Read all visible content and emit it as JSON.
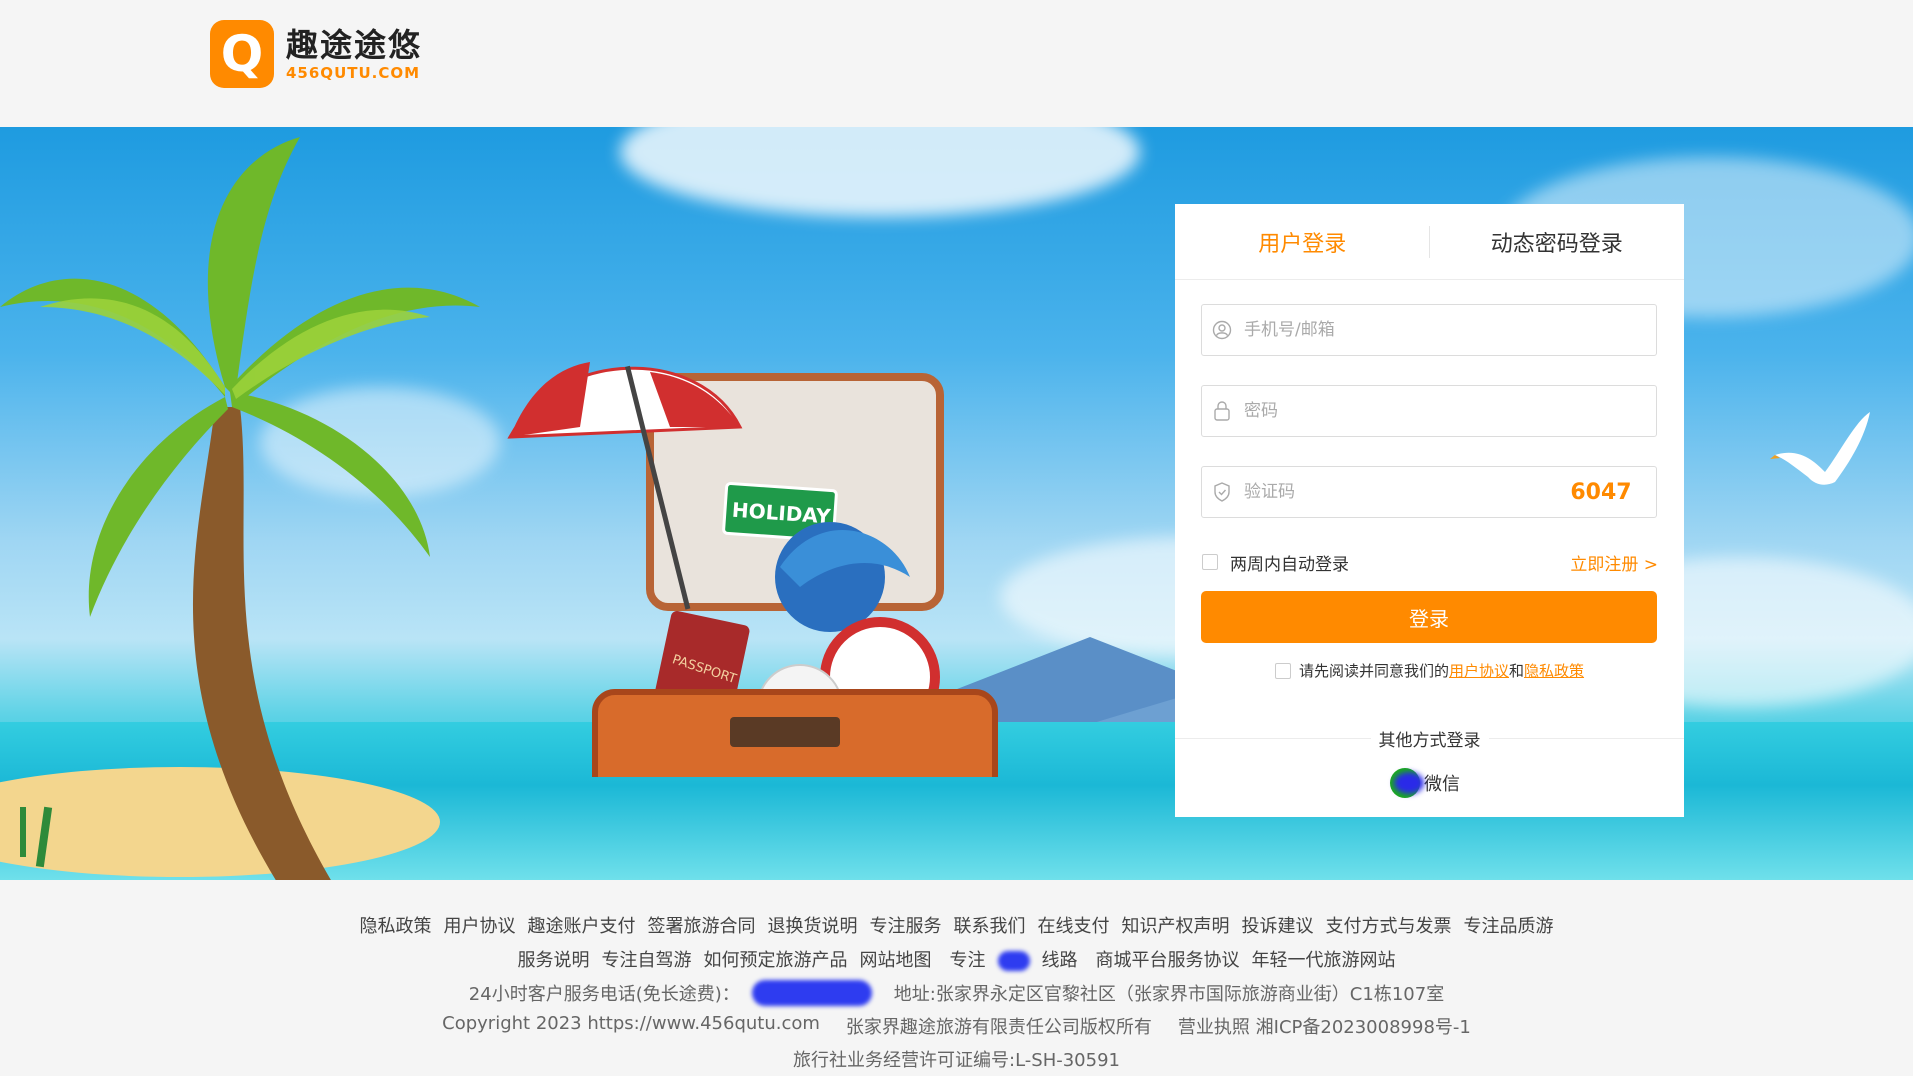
{
  "header": {
    "logo_mark": "Q",
    "logo_cn": "趣途途悠",
    "logo_en": "456QUTU.COM"
  },
  "hero": {
    "sign_text": "HOLIDAY",
    "passport_text": "PASSPORT"
  },
  "login": {
    "tabs": [
      {
        "label": "用户登录",
        "active": true
      },
      {
        "label": "动态密码登录",
        "active": false
      }
    ],
    "phone_placeholder": "手机号/邮箱",
    "password_placeholder": "密码",
    "captcha_placeholder": "验证码",
    "captcha_code": "6047",
    "remember_label": "两周内自动登录",
    "register_link": "立即注册 >",
    "submit_label": "登录",
    "agree_prefix": "请先阅读并同意我们的",
    "agree_user_link": "用户协议",
    "agree_and": "和",
    "agree_privacy_link": "隐私政策",
    "other_title": "其他方式登录",
    "wechat_label": "微信"
  },
  "footer": {
    "links_row1": [
      "隐私政策",
      "用户协议",
      "趣途账户支付",
      "签署旅游合同",
      "退换货说明",
      "专注服务",
      "联系我们",
      "在线支付",
      "知识产权声明",
      "投诉建议",
      "支付方式与发票",
      "专注品质游"
    ],
    "links_row2": [
      "服务说明",
      "专注自驾游",
      "如何预定旅游产品",
      "网站地图",
      "专注",
      "线路",
      "商城平台服务协议",
      "年轻一代旅游网站"
    ],
    "hotline_label": "24小时客户服务电话(免长途费)：",
    "address": "地址:张家界永定区官黎社区（张家界市国际旅游商业街）C1栋107室",
    "copyright": "Copyright 2023 https://www.456qutu.com",
    "company": "张家界趣途旅游有限责任公司版权所有",
    "icp": "营业执照 湘ICP备2023008998号-1",
    "license": "旅行社业务经营许可证编号:L-SH-30591"
  },
  "colors": {
    "accent": "#ff8a00",
    "wechat": "#1aad19"
  }
}
